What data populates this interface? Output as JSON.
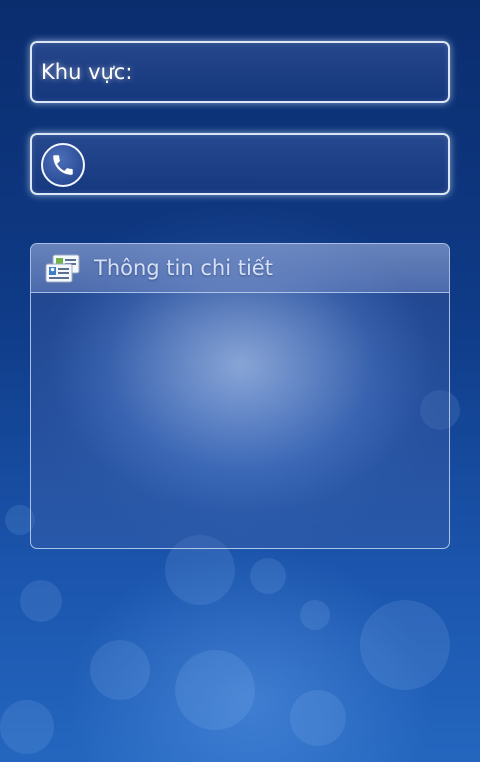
{
  "region_field": {
    "label": "Khu vực:"
  },
  "phone_field": {
    "icon": "phone-icon"
  },
  "detail_panel": {
    "icon": "contact-card-icon",
    "title": "Thông tin chi tiết"
  },
  "colors": {
    "background_top": "#0a2d6e",
    "background_bottom": "#2466bf",
    "border": "#ebf5ff",
    "text": "#ffffff"
  }
}
